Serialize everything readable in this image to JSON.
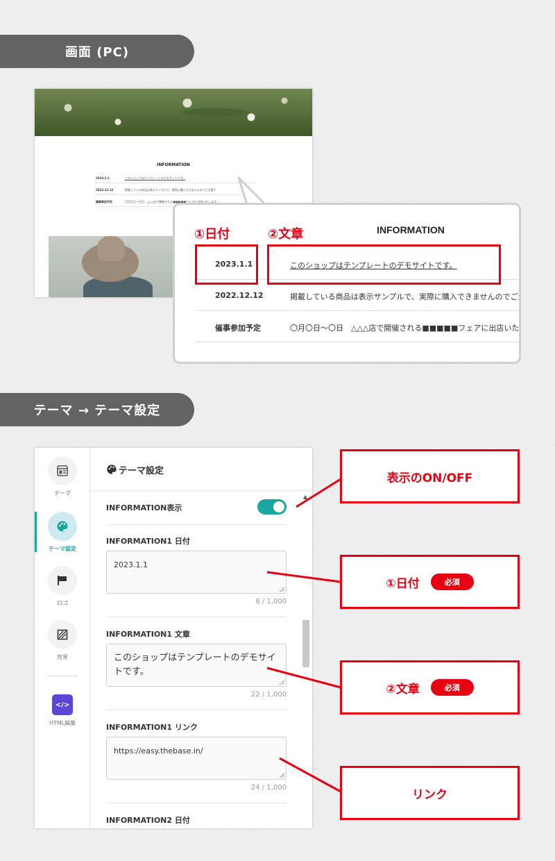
{
  "sections": {
    "pc_title": "画面 (PC)",
    "settings_title": "テーマ → テーマ設定"
  },
  "pc_preview": {
    "info_title": "INFORMATION",
    "rows": [
      {
        "date": "2023.1.1",
        "text": "このショップはテンプレートのデモサイトです。"
      },
      {
        "date": "2022.12.12",
        "text": "掲載している商品は表示サンプルで、実際に購入できませんのでご注意下"
      },
      {
        "date": "催事参加予定",
        "text": "〇月〇日～〇日　△△△店で開催される■■■■■フェアに出店いたします。"
      }
    ]
  },
  "callout": {
    "title": "INFORMATION",
    "label_date": "①日付",
    "label_text": "②文章",
    "rows": [
      {
        "date": "2023.1.1",
        "text": "このショップはテンプレートのデモサイトです。"
      },
      {
        "date": "2022.12.12",
        "text": "掲載している商品は表示サンプルで、実際に購入できませんのでご注意下"
      },
      {
        "date": "催事参加予定",
        "text": "〇月〇日～〇日　△△△店で開催される■■■■■フェアに出店いたします。"
      }
    ]
  },
  "sidebar": {
    "items": [
      {
        "label": "テーマ",
        "icon": "layout-icon"
      },
      {
        "label": "テーマ設定",
        "icon": "palette-icon",
        "active": true
      },
      {
        "label": "ロゴ",
        "icon": "flag-icon"
      },
      {
        "label": "背景",
        "icon": "pattern-icon"
      },
      {
        "label": "HTML編集",
        "icon": "code-icon",
        "icon_text": "</>"
      }
    ]
  },
  "settings": {
    "title": "テーマ設定",
    "info_toggle_label": "INFORMATION表示",
    "info_toggle_on": true,
    "fields": [
      {
        "label": "INFORMATION1 日付",
        "value": "2023.1.1",
        "count": "8 / 1,000"
      },
      {
        "label": "INFORMATION1 文章",
        "value": "このショップはテンプレートのデモサイトです。",
        "count": "22 / 1,000"
      },
      {
        "label": "INFORMATION1 リンク",
        "value": "https://easy.thebase.in/",
        "count": "24 / 1,000"
      },
      {
        "label": "INFORMATION2 日付"
      }
    ]
  },
  "annotations": {
    "onoff": "表示のON/OFF",
    "date": "①日付",
    "text": "②文章",
    "link": "リンク",
    "required": "必須"
  },
  "colors": {
    "accent_red": "#e60012",
    "teal": "#1aa5a0",
    "pill_gray": "#636363"
  }
}
